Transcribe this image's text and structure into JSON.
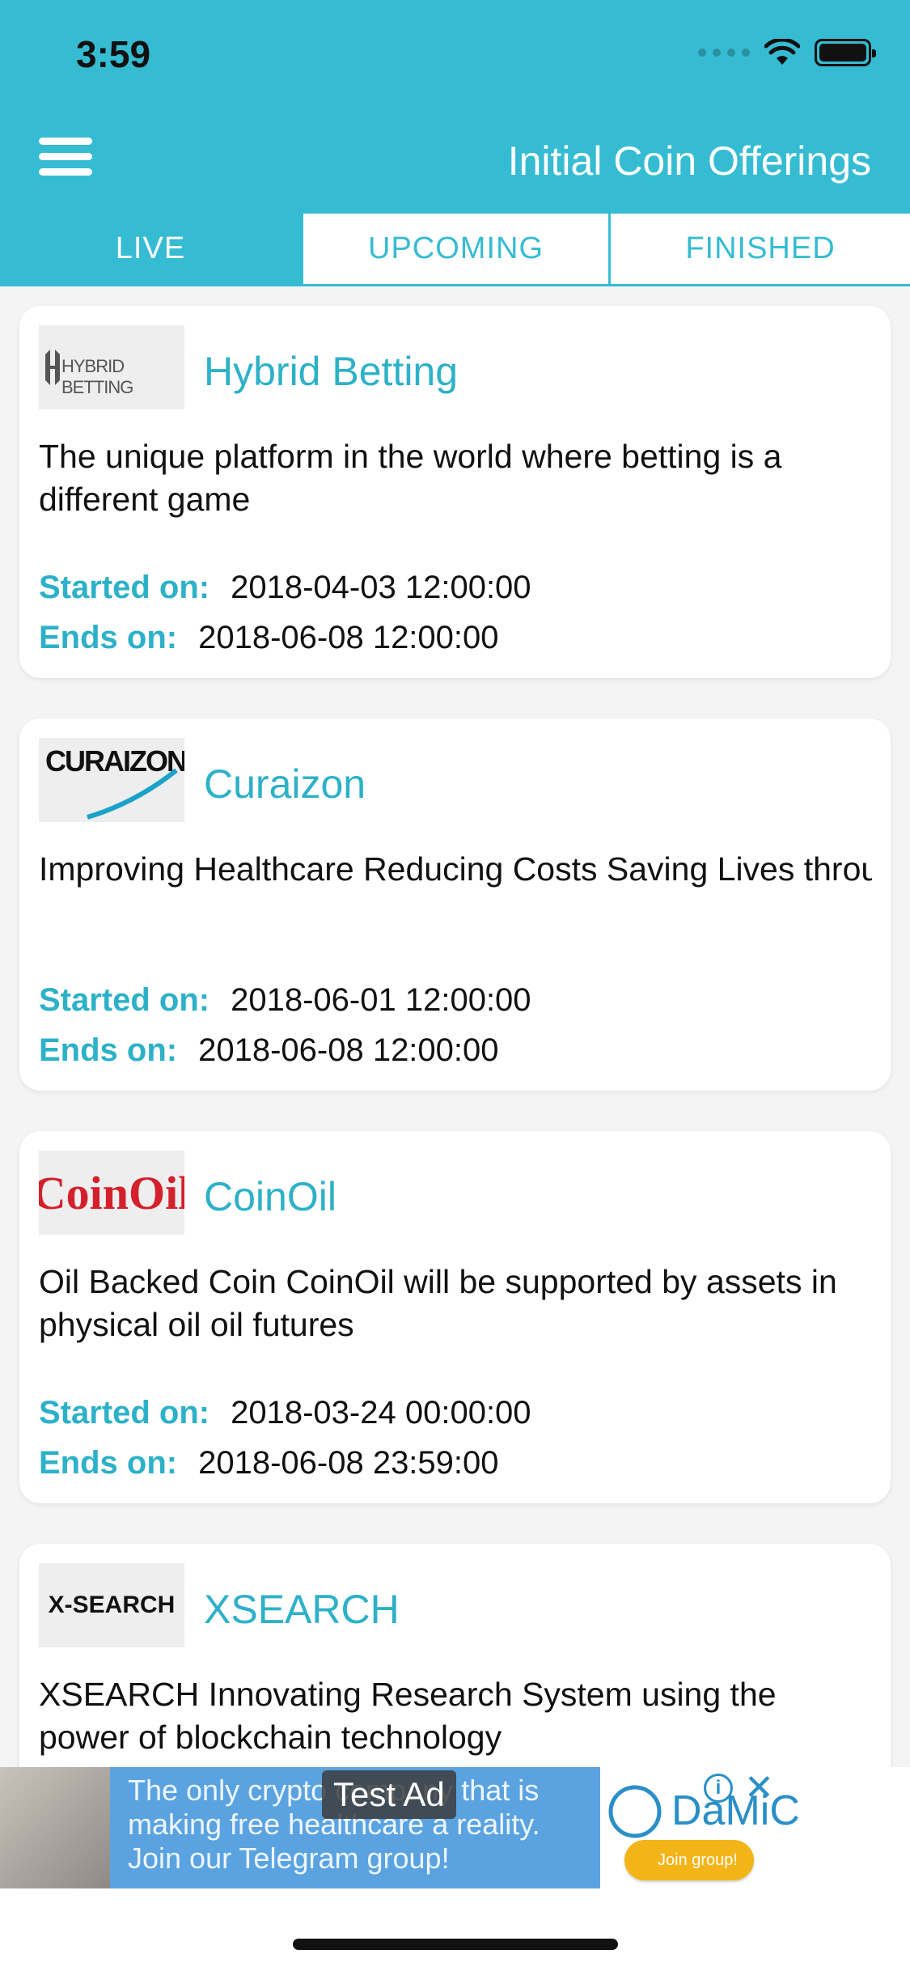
{
  "status_bar": {
    "time": "3:59"
  },
  "header": {
    "title": "Initial Coin Offerings",
    "menu_icon": "hamburger-menu-icon"
  },
  "tabs": [
    {
      "label": "LIVE",
      "active": true
    },
    {
      "label": "UPCOMING",
      "active": false
    },
    {
      "label": "FINISHED",
      "active": false
    }
  ],
  "labels": {
    "started": "Started on:",
    "ends": "Ends on:"
  },
  "icos": [
    {
      "name": "Hybrid Betting",
      "logo_text": "HYBRID BETTING",
      "description": "The unique platform in the world where betting is a different game",
      "started": "2018-04-03 12:00:00",
      "ends": "2018-06-08 12:00:00"
    },
    {
      "name": "Curaizon",
      "logo_text": "CURAIZON",
      "description": "Improving Healthcare Reducing Costs  Saving Lives through the power of Blockchain Technolo...",
      "started": "2018-06-01 12:00:00",
      "ends": "2018-06-08 12:00:00"
    },
    {
      "name": "CoinOil",
      "logo_text": "CoinOil",
      "description": "Oil Backed Coin CoinOil will be supported by assets in physical oil  oil futures",
      "started": "2018-03-24 00:00:00",
      "ends": "2018-06-08 23:59:00"
    },
    {
      "name": "XSEARCH",
      "logo_text": "X-SEARCH",
      "description": "XSEARCH  Innovating Research System using the power of blockchain technology",
      "started": "",
      "ends": ""
    }
  ],
  "ad": {
    "label": "Test Ad",
    "text": "The only crypto company that is making free healthcare a reality. Join our Telegram group!",
    "brand": "DaMiC",
    "cta": "Join group!"
  },
  "colors": {
    "accent": "#36bcd2",
    "text": "#111111"
  }
}
